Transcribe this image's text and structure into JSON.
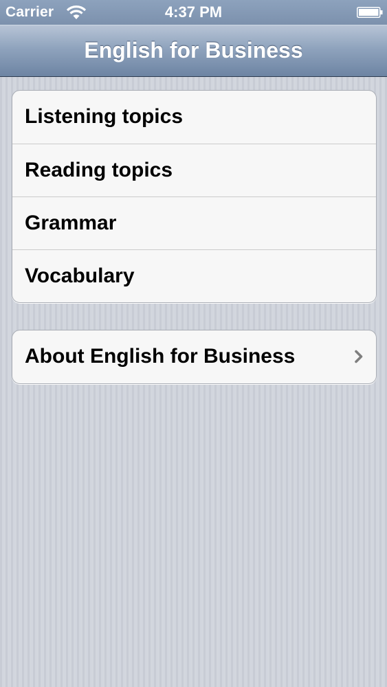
{
  "status_bar": {
    "carrier": "Carrier",
    "time": "4:37 PM",
    "wifi_icon": "wifi-icon",
    "battery_icon": "battery-icon"
  },
  "nav_bar": {
    "title": "English for Business"
  },
  "menu": {
    "items": [
      {
        "label": "Listening topics"
      },
      {
        "label": "Reading topics"
      },
      {
        "label": "Grammar"
      },
      {
        "label": "Vocabulary"
      }
    ]
  },
  "about": {
    "label": "About English for Business",
    "icon": "chevron-right-icon"
  },
  "colors": {
    "nav_bar_top": "#b7c4d6",
    "nav_bar_bottom": "#6d84a3",
    "background": "#cdd1da",
    "cell_background": "#f7f7f7",
    "chevron": "#7f7f7f"
  }
}
